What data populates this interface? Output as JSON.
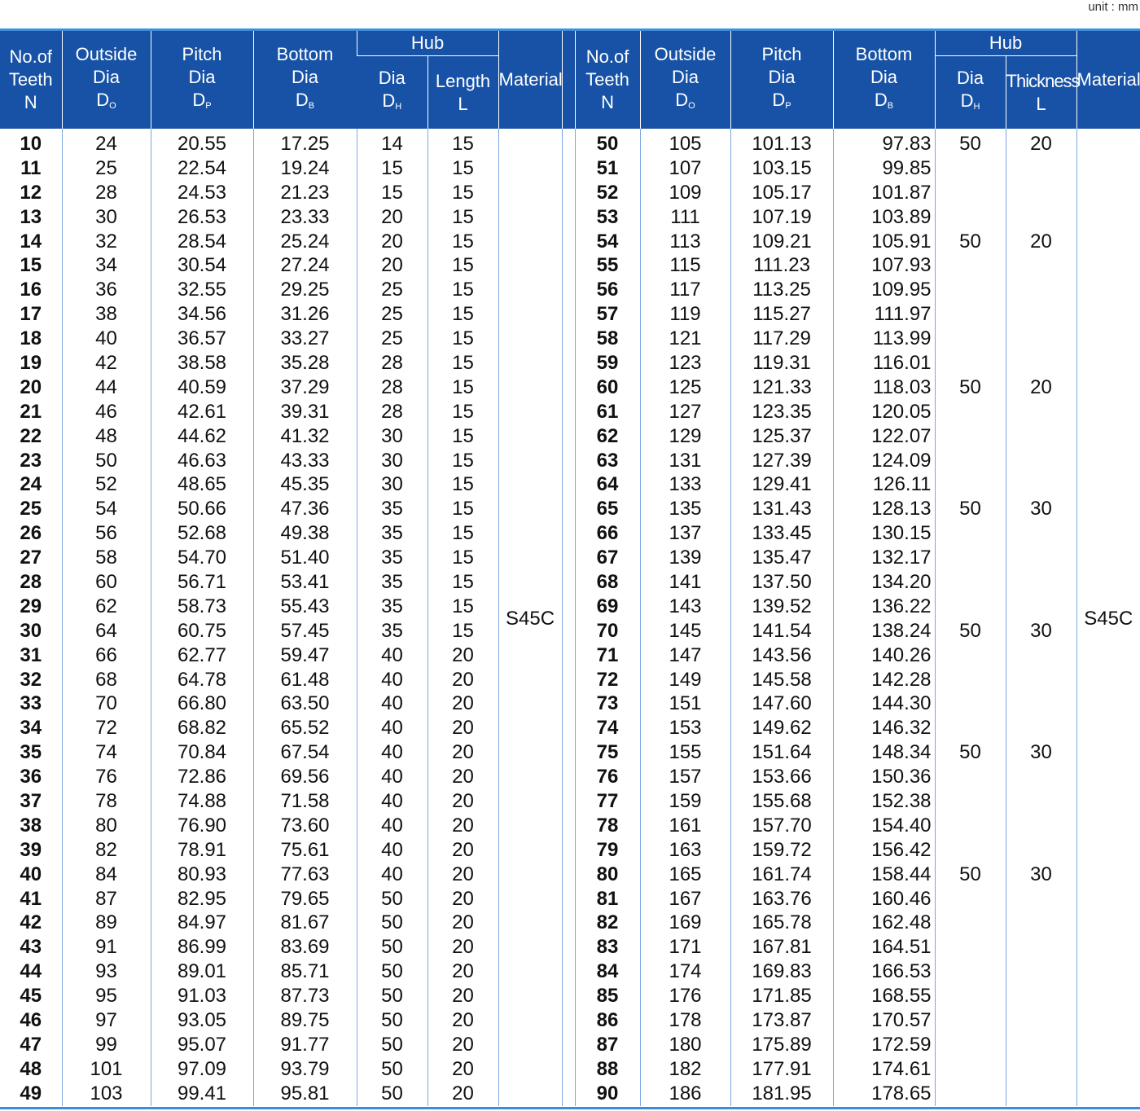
{
  "unit_label": "unit : mm",
  "header": {
    "teeth": [
      "No.of",
      "Teeth",
      "N"
    ],
    "outside": [
      "Outside",
      "Dia",
      "D",
      "O"
    ],
    "pitch": [
      "Pitch",
      "Dia",
      "D",
      "P"
    ],
    "bottom": [
      "Bottom",
      "Dia",
      "D",
      "B"
    ],
    "hub": "Hub",
    "hub_dia": [
      "Dia",
      "D",
      "H"
    ],
    "hub_length": [
      "Length",
      "L"
    ],
    "hub_thickness": [
      "Thickness",
      "L"
    ],
    "material": "Material"
  },
  "left_material": "S45C",
  "right_material": "S45C",
  "left_rows": [
    [
      "10",
      "24",
      "20.55",
      "17.25",
      "14",
      "15"
    ],
    [
      "11",
      "25",
      "22.54",
      "19.24",
      "15",
      "15"
    ],
    [
      "12",
      "28",
      "24.53",
      "21.23",
      "15",
      "15"
    ],
    [
      "13",
      "30",
      "26.53",
      "23.33",
      "20",
      "15"
    ],
    [
      "14",
      "32",
      "28.54",
      "25.24",
      "20",
      "15"
    ],
    [
      "15",
      "34",
      "30.54",
      "27.24",
      "20",
      "15"
    ],
    [
      "16",
      "36",
      "32.55",
      "29.25",
      "25",
      "15"
    ],
    [
      "17",
      "38",
      "34.56",
      "31.26",
      "25",
      "15"
    ],
    [
      "18",
      "40",
      "36.57",
      "33.27",
      "25",
      "15"
    ],
    [
      "19",
      "42",
      "38.58",
      "35.28",
      "28",
      "15"
    ],
    [
      "20",
      "44",
      "40.59",
      "37.29",
      "28",
      "15"
    ],
    [
      "21",
      "46",
      "42.61",
      "39.31",
      "28",
      "15"
    ],
    [
      "22",
      "48",
      "44.62",
      "41.32",
      "30",
      "15"
    ],
    [
      "23",
      "50",
      "46.63",
      "43.33",
      "30",
      "15"
    ],
    [
      "24",
      "52",
      "48.65",
      "45.35",
      "30",
      "15"
    ],
    [
      "25",
      "54",
      "50.66",
      "47.36",
      "35",
      "15"
    ],
    [
      "26",
      "56",
      "52.68",
      "49.38",
      "35",
      "15"
    ],
    [
      "27",
      "58",
      "54.70",
      "51.40",
      "35",
      "15"
    ],
    [
      "28",
      "60",
      "56.71",
      "53.41",
      "35",
      "15"
    ],
    [
      "29",
      "62",
      "58.73",
      "55.43",
      "35",
      "15"
    ],
    [
      "30",
      "64",
      "60.75",
      "57.45",
      "35",
      "15"
    ],
    [
      "31",
      "66",
      "62.77",
      "59.47",
      "40",
      "20"
    ],
    [
      "32",
      "68",
      "64.78",
      "61.48",
      "40",
      "20"
    ],
    [
      "33",
      "70",
      "66.80",
      "63.50",
      "40",
      "20"
    ],
    [
      "34",
      "72",
      "68.82",
      "65.52",
      "40",
      "20"
    ],
    [
      "35",
      "74",
      "70.84",
      "67.54",
      "40",
      "20"
    ],
    [
      "36",
      "76",
      "72.86",
      "69.56",
      "40",
      "20"
    ],
    [
      "37",
      "78",
      "74.88",
      "71.58",
      "40",
      "20"
    ],
    [
      "38",
      "80",
      "76.90",
      "73.60",
      "40",
      "20"
    ],
    [
      "39",
      "82",
      "78.91",
      "75.61",
      "40",
      "20"
    ],
    [
      "40",
      "84",
      "80.93",
      "77.63",
      "40",
      "20"
    ],
    [
      "41",
      "87",
      "82.95",
      "79.65",
      "50",
      "20"
    ],
    [
      "42",
      "89",
      "84.97",
      "81.67",
      "50",
      "20"
    ],
    [
      "43",
      "91",
      "86.99",
      "83.69",
      "50",
      "20"
    ],
    [
      "44",
      "93",
      "89.01",
      "85.71",
      "50",
      "20"
    ],
    [
      "45",
      "95",
      "91.03",
      "87.73",
      "50",
      "20"
    ],
    [
      "46",
      "97",
      "93.05",
      "89.75",
      "50",
      "20"
    ],
    [
      "47",
      "99",
      "95.07",
      "91.77",
      "50",
      "20"
    ],
    [
      "48",
      "101",
      "97.09",
      "93.79",
      "50",
      "20"
    ],
    [
      "49",
      "103",
      "99.41",
      "95.81",
      "50",
      "20"
    ]
  ],
  "right_rows": [
    [
      "50",
      "105",
      "101.13",
      "97.83",
      "50",
      "20"
    ],
    [
      "51",
      "107",
      "103.15",
      "99.85",
      "",
      ""
    ],
    [
      "52",
      "109",
      "105.17",
      "101.87",
      "",
      ""
    ],
    [
      "53",
      "111",
      "107.19",
      "103.89",
      "",
      ""
    ],
    [
      "54",
      "113",
      "109.21",
      "105.91",
      "50",
      "20"
    ],
    [
      "55",
      "115",
      "111.23",
      "107.93",
      "",
      ""
    ],
    [
      "56",
      "117",
      "113.25",
      "109.95",
      "",
      ""
    ],
    [
      "57",
      "119",
      "115.27",
      "111.97",
      "",
      ""
    ],
    [
      "58",
      "121",
      "117.29",
      "113.99",
      "",
      ""
    ],
    [
      "59",
      "123",
      "119.31",
      "116.01",
      "",
      ""
    ],
    [
      "60",
      "125",
      "121.33",
      "118.03",
      "50",
      "20"
    ],
    [
      "61",
      "127",
      "123.35",
      "120.05",
      "",
      ""
    ],
    [
      "62",
      "129",
      "125.37",
      "122.07",
      "",
      ""
    ],
    [
      "63",
      "131",
      "127.39",
      "124.09",
      "",
      ""
    ],
    [
      "64",
      "133",
      "129.41",
      "126.11",
      "",
      ""
    ],
    [
      "65",
      "135",
      "131.43",
      "128.13",
      "50",
      "30"
    ],
    [
      "66",
      "137",
      "133.45",
      "130.15",
      "",
      ""
    ],
    [
      "67",
      "139",
      "135.47",
      "132.17",
      "",
      ""
    ],
    [
      "68",
      "141",
      "137.50",
      "134.20",
      "",
      ""
    ],
    [
      "69",
      "143",
      "139.52",
      "136.22",
      "",
      ""
    ],
    [
      "70",
      "145",
      "141.54",
      "138.24",
      "50",
      "30"
    ],
    [
      "71",
      "147",
      "143.56",
      "140.26",
      "",
      ""
    ],
    [
      "72",
      "149",
      "145.58",
      "142.28",
      "",
      ""
    ],
    [
      "73",
      "151",
      "147.60",
      "144.30",
      "",
      ""
    ],
    [
      "74",
      "153",
      "149.62",
      "146.32",
      "",
      ""
    ],
    [
      "75",
      "155",
      "151.64",
      "148.34",
      "50",
      "30"
    ],
    [
      "76",
      "157",
      "153.66",
      "150.36",
      "",
      ""
    ],
    [
      "77",
      "159",
      "155.68",
      "152.38",
      "",
      ""
    ],
    [
      "78",
      "161",
      "157.70",
      "154.40",
      "",
      ""
    ],
    [
      "79",
      "163",
      "159.72",
      "156.42",
      "",
      ""
    ],
    [
      "80",
      "165",
      "161.74",
      "158.44",
      "50",
      "30"
    ],
    [
      "81",
      "167",
      "163.76",
      "160.46",
      "",
      ""
    ],
    [
      "82",
      "169",
      "165.78",
      "162.48",
      "",
      ""
    ],
    [
      "83",
      "171",
      "167.81",
      "164.51",
      "",
      ""
    ],
    [
      "84",
      "174",
      "169.83",
      "166.53",
      "",
      ""
    ],
    [
      "85",
      "176",
      "171.85",
      "168.55",
      "",
      ""
    ],
    [
      "86",
      "178",
      "173.87",
      "170.57",
      "",
      ""
    ],
    [
      "87",
      "180",
      "175.89",
      "172.59",
      "",
      ""
    ],
    [
      "88",
      "182",
      "177.91",
      "174.61",
      "",
      ""
    ],
    [
      "90",
      "186",
      "181.95",
      "178.65",
      "",
      ""
    ]
  ]
}
